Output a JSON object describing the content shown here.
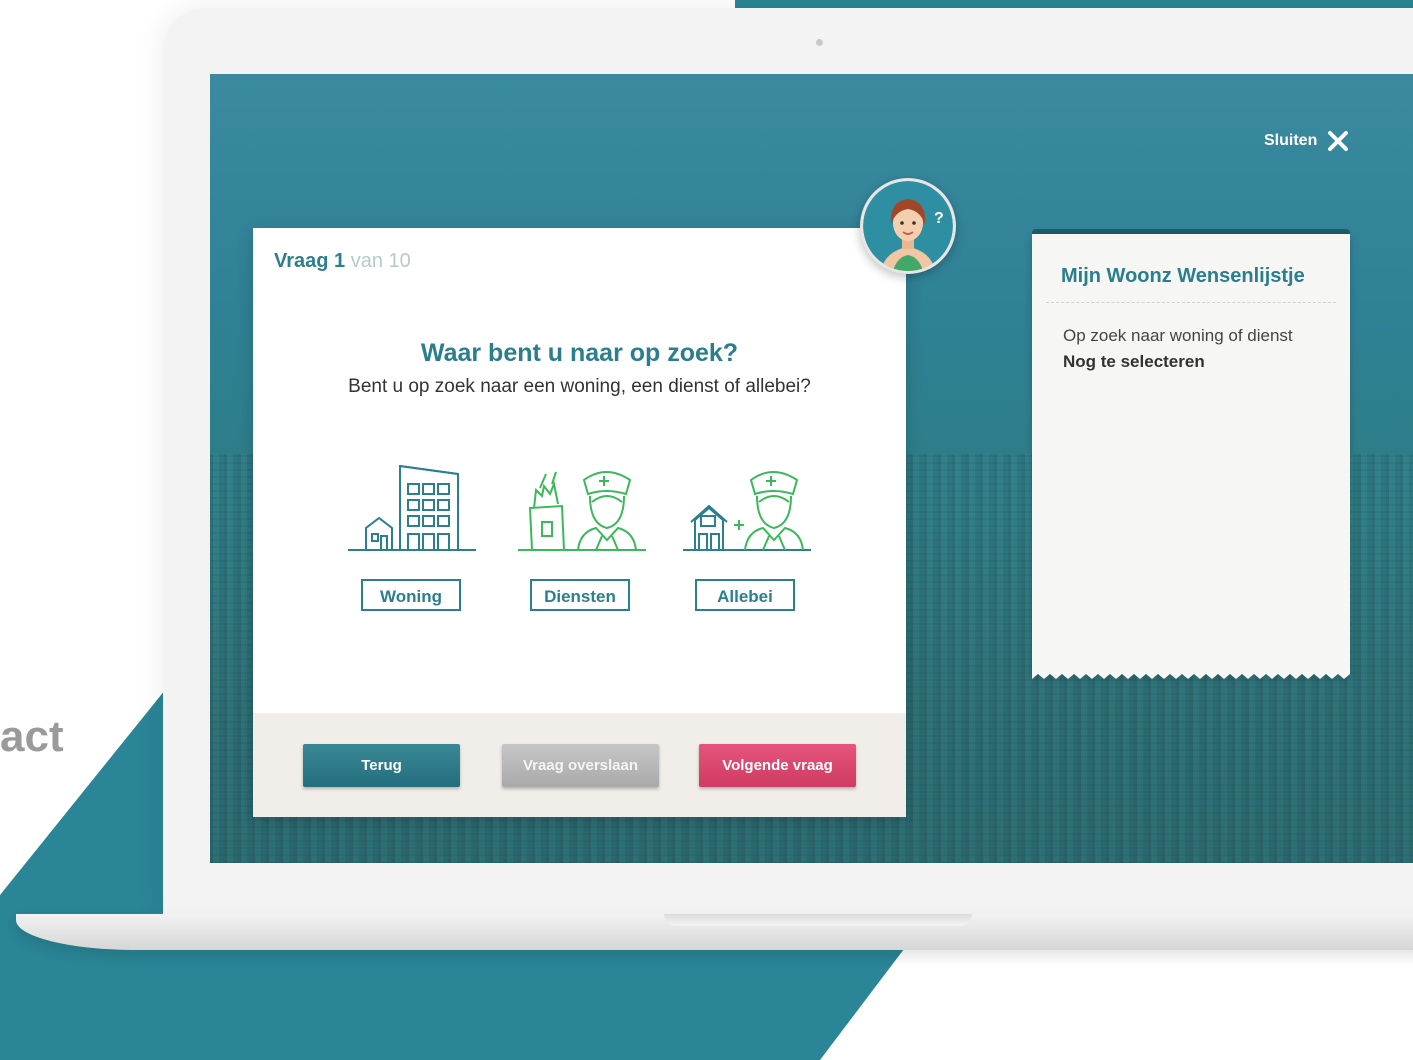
{
  "background": {
    "partial_text": "act",
    "accent_color": "#2a8596"
  },
  "app": {
    "close_label": "Sluiten"
  },
  "question": {
    "label_prefix": "Vraag",
    "number": "1",
    "of_text": "van 10",
    "title": "Waar bent u naar op zoek?",
    "subtitle": "Bent u op zoek naar een woning, een dienst of allebei?"
  },
  "options": [
    {
      "label": "Woning",
      "icon": "building-icon"
    },
    {
      "label": "Diensten",
      "icon": "nurse-icon"
    },
    {
      "label": "Allebei",
      "icon": "house-plus-nurse-icon"
    }
  ],
  "footer": {
    "back_label": "Terug",
    "skip_label": "Vraag overslaan",
    "next_label": "Volgende vraag"
  },
  "wishlist": {
    "title": "Mijn Woonz Wensenlijstje",
    "item_label": "Op zoek naar woning of dienst",
    "item_value": "Nog te selecteren"
  },
  "colors": {
    "primary": "#2b7f8e",
    "accent_pink": "#d9446c",
    "icon_green": "#3bb85a",
    "screen_teal": "#2f8195"
  }
}
